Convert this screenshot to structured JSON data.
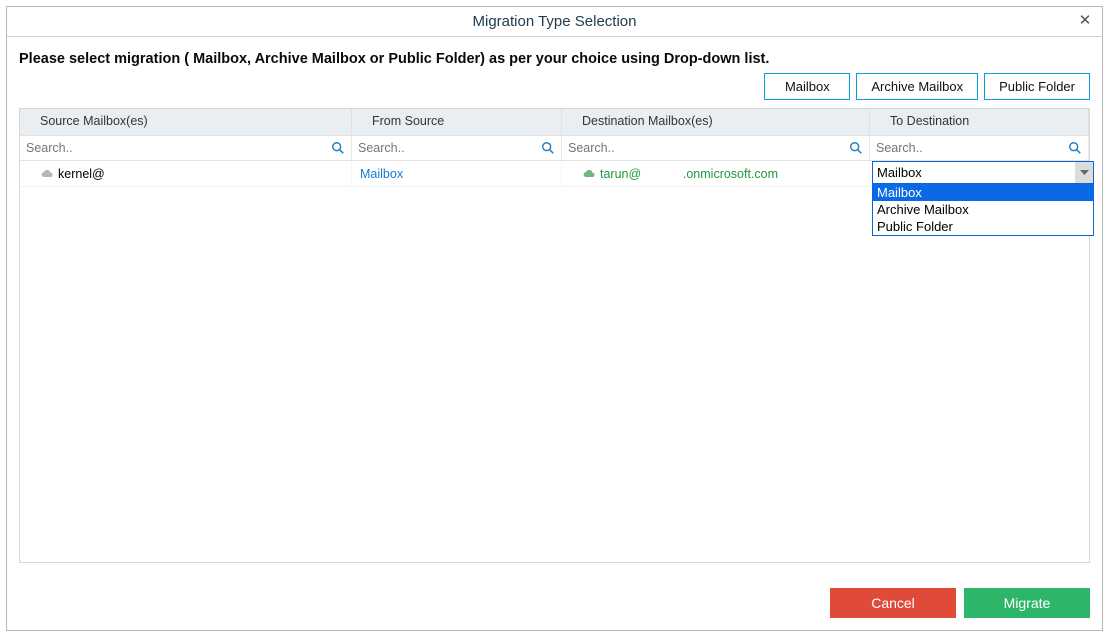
{
  "title": "Migration Type Selection",
  "instruction": "Please select migration ( Mailbox, Archive Mailbox or Public Folder) as per your choice using Drop-down list.",
  "top_buttons": {
    "mailbox": "Mailbox",
    "archive": "Archive Mailbox",
    "public": "Public Folder"
  },
  "columns": {
    "source": "Source Mailbox(es)",
    "from": "From Source",
    "dest": "Destination Mailbox(es)",
    "to": "To Destination"
  },
  "search_placeholder": "Search..",
  "row": {
    "source_mailbox": "kernel@",
    "from_source": "Mailbox",
    "dest_prefix": "tarun@",
    "dest_suffix": ".onmicrosoft.com"
  },
  "dropdown": {
    "selected": "Mailbox",
    "options": [
      "Mailbox",
      "Archive Mailbox",
      "Public Folder"
    ]
  },
  "footer": {
    "cancel": "Cancel",
    "migrate": "Migrate"
  }
}
